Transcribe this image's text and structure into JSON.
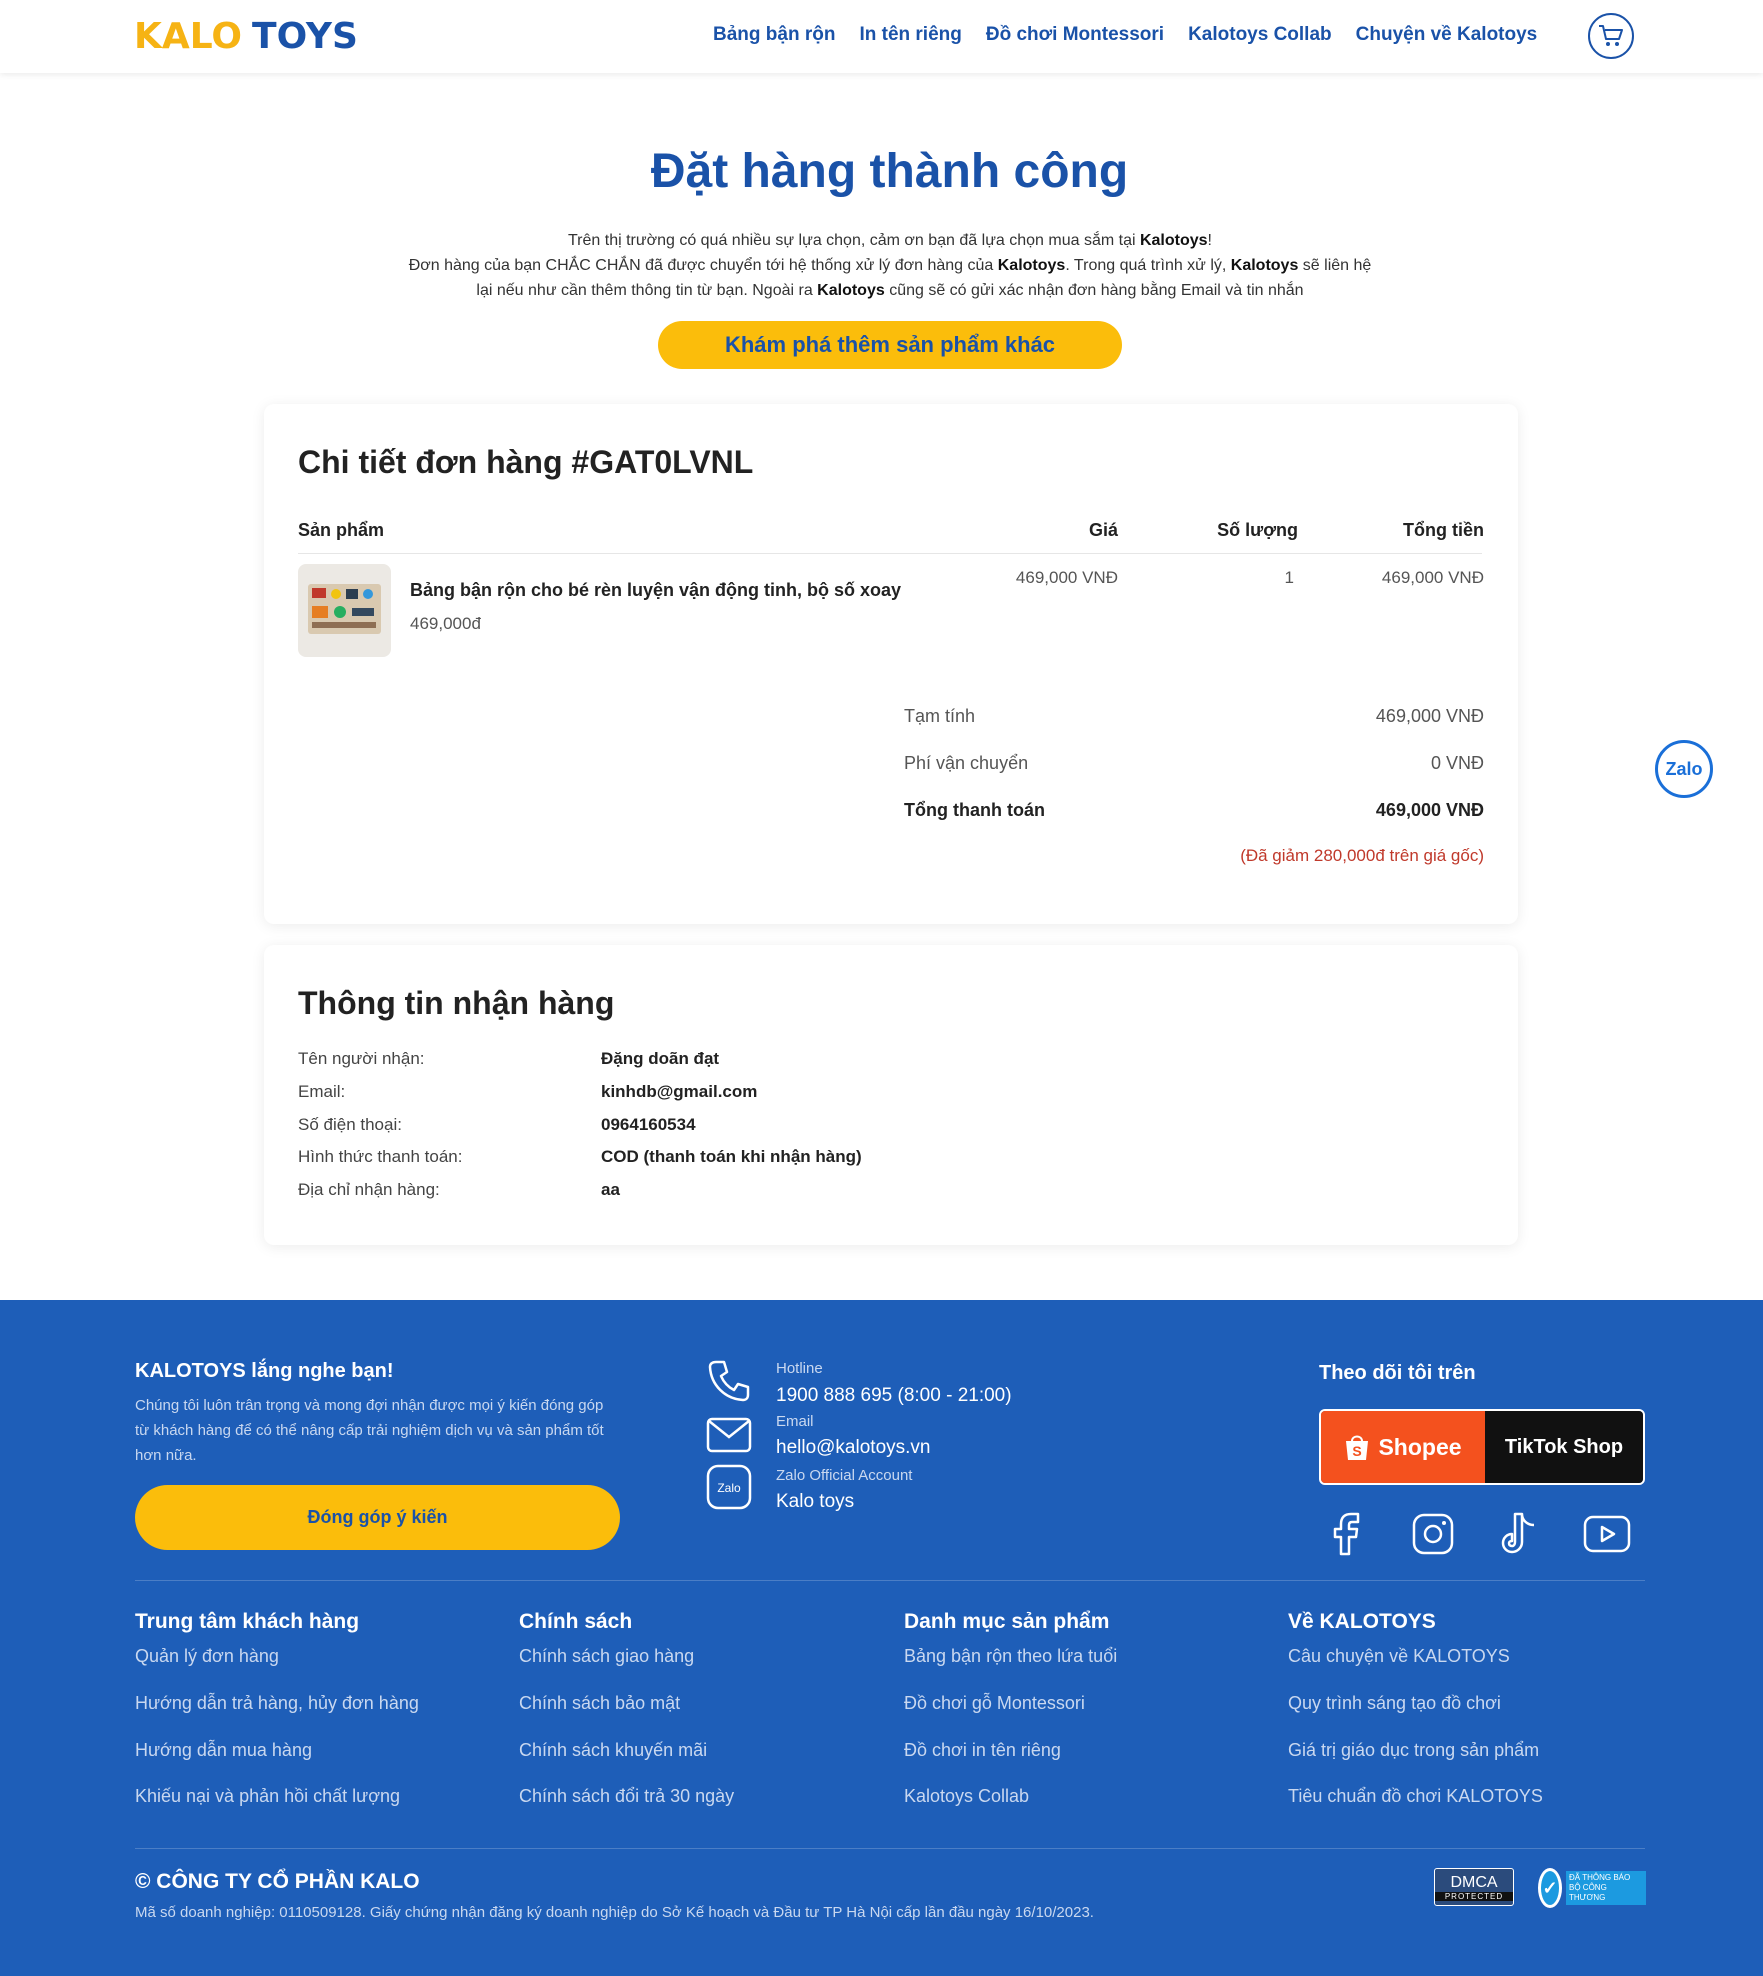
{
  "header": {
    "logo_left": "KALO",
    "logo_right": "TOYS",
    "nav": [
      "Bảng bận rộn",
      "In tên riêng",
      "Đồ chơi Montessori",
      "Kalotoys Collab",
      "Chuyện về Kalotoys"
    ]
  },
  "hero": {
    "title": "Đặt hàng thành công",
    "line1_a": "Trên thị trường có quá nhiều sự lựa chọn, cảm ơn bạn đã lựa chọn mua sắm tại ",
    "brand": "Kalotoys",
    "line1_b": "!",
    "line2_a": "Đơn hàng của bạn CHẮC CHẮN đã được chuyển tới hệ thống xử lý đơn hàng của ",
    "line2_b": ". Trong quá trình xử lý, ",
    "line2_c": " sẽ liên hệ",
    "line3_a": "lại nếu như cần thêm thông tin từ bạn. Ngoài ra ",
    "line3_b": " cũng sẽ có gửi xác nhận đơn hàng bằng Email và tin nhắn",
    "cta": "Khám phá thêm sản phẩm khác"
  },
  "order": {
    "title": "Chi tiết đơn hàng #GAT0LVNL",
    "columns": {
      "product": "Sản phẩm",
      "price": "Giá",
      "qty": "Số lượng",
      "total": "Tổng tiền"
    },
    "items": [
      {
        "name": "Bảng bận rộn cho bé rèn luyện vận động tinh, bộ số xoay",
        "unit_price": "469,000đ",
        "price": "469,000 VNĐ",
        "qty": "1",
        "total": "469,000 VNĐ"
      }
    ],
    "summary": {
      "subtotal_label": "Tạm tính",
      "subtotal": "469,000 VNĐ",
      "shipping_label": "Phí vận chuyển",
      "shipping": "0 VNĐ",
      "grand_label": "Tổng thanh toán",
      "grand": "469,000 VNĐ",
      "discount_note": "(Đã giảm 280,000đ trên giá gốc)"
    }
  },
  "shipping": {
    "title": "Thông tin nhận hàng",
    "rows": [
      {
        "label": "Tên người nhận:",
        "value": "Đặng doãn đạt"
      },
      {
        "label": "Email:",
        "value": "kinhdb@gmail.com"
      },
      {
        "label": "Số điện thoại:",
        "value": "0964160534"
      },
      {
        "label": "Hình thức thanh toán:",
        "value": "COD (thanh toán khi nhận hàng)"
      },
      {
        "label": "Địa chỉ nhận hàng:",
        "value": "aa"
      }
    ]
  },
  "zalo_float": "Zalo",
  "footer": {
    "listen_title": "KALOTOYS lắng nghe bạn!",
    "listen_text": "Chúng tôi luôn trân trọng và mong đợi nhận được mọi ý kiến đóng góp từ khách hàng để có thể nâng cấp trải nghiệm dịch vụ và sản phẩm tốt hơn nữa.",
    "feedback_button": "Đóng góp ý kiến",
    "hotline_label": "Hotline",
    "hotline": "1900 888 695 (8:00 - 21:00)",
    "email_label": "Email",
    "email": "hello@kalotoys.vn",
    "zalo_label": "Zalo Official Account",
    "zalo": "Kalo toys",
    "follow_title": "Theo dõi tôi trên",
    "shopee": "Shopee",
    "tiktok_shop": "TikTok Shop",
    "columns": [
      {
        "title": "Trung tâm khách hàng",
        "items": [
          "Quản lý đơn hàng",
          "Hướng dẫn trả hàng, hủy đơn hàng",
          "Hướng dẫn mua hàng",
          "Khiếu nại và phản hồi chất lượng"
        ]
      },
      {
        "title": "Chính sách",
        "items": [
          "Chính sách giao hàng",
          "Chính sách bảo mật",
          "Chính sách khuyến mãi",
          "Chính sách đổi trả 30 ngày"
        ]
      },
      {
        "title": "Danh mục sản phẩm",
        "items": [
          "Bảng bận rộn theo lứa tuổi",
          "Đồ chơi gỗ Montessori",
          "Đồ chơi in tên riêng",
          "Kalotoys Collab"
        ]
      },
      {
        "title": "Về KALOTOYS",
        "items": [
          "Câu chuyện về KALOTOYS",
          "Quy trình sáng tạo đồ chơi",
          "Giá trị giáo dục trong sản phẩm",
          "Tiêu chuẩn đồ chơi KALOTOYS"
        ]
      }
    ],
    "company": "© CÔNG TY CỔ PHẦN KALO",
    "company_sub": "Mã số doanh nghiệp: 0110509128. Giấy chứng nhận đăng ký doanh nghiệp do Sở Kế hoạch và Đầu tư TP Hà Nội cấp lần đầu ngày 16/10/2023.",
    "dmca": "DMCA",
    "dmca_sub": "PROTECTED",
    "bct": "ĐÃ THÔNG BÁO BỘ CÔNG THƯƠNG"
  },
  "colors": {
    "brand_blue": "#1a52a8",
    "brand_yellow": "#fbbd0b",
    "footer_blue": "#1e5eb8",
    "discount_red": "#c0392b"
  }
}
